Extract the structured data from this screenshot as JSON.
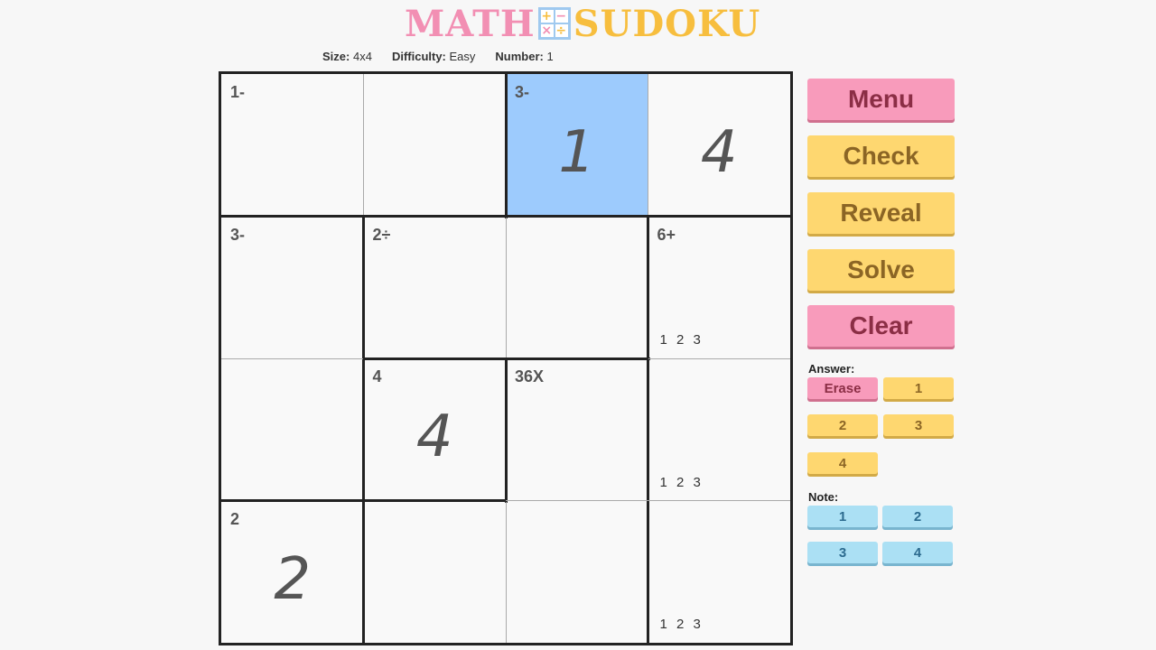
{
  "title": {
    "part1": "MATH",
    "part2": "SUDOKU",
    "logo": [
      "+",
      "−",
      "×",
      "÷"
    ]
  },
  "info": {
    "size_label": "Size:",
    "size": "4x4",
    "difficulty_label": "Difficulty:",
    "difficulty": "Easy",
    "number_label": "Number:",
    "number": "1"
  },
  "board": {
    "cells": [
      {
        "cage": "1-",
        "value": "",
        "notes": ""
      },
      {
        "cage": "",
        "value": "",
        "notes": ""
      },
      {
        "cage": "3-",
        "value": "1",
        "notes": "",
        "selected": true
      },
      {
        "cage": "",
        "value": "4",
        "notes": ""
      },
      {
        "cage": "3-",
        "value": "",
        "notes": ""
      },
      {
        "cage": "2÷",
        "value": "",
        "notes": ""
      },
      {
        "cage": "",
        "value": "",
        "notes": ""
      },
      {
        "cage": "6+",
        "value": "",
        "notes": "1 2 3"
      },
      {
        "cage": "",
        "value": "",
        "notes": ""
      },
      {
        "cage": "4",
        "value": "4",
        "notes": ""
      },
      {
        "cage": "36X",
        "value": "",
        "notes": ""
      },
      {
        "cage": "",
        "value": "",
        "notes": "1 2 3"
      },
      {
        "cage": "2",
        "value": "2",
        "notes": ""
      },
      {
        "cage": "",
        "value": "",
        "notes": ""
      },
      {
        "cage": "",
        "value": "",
        "notes": ""
      },
      {
        "cage": "",
        "value": "",
        "notes": "1 2 3"
      }
    ]
  },
  "buttons": {
    "menu": "Menu",
    "check": "Check",
    "reveal": "Reveal",
    "solve": "Solve",
    "clear": "Clear"
  },
  "answer": {
    "label": "Answer:",
    "erase": "Erase",
    "options": [
      "1",
      "2",
      "3",
      "4"
    ]
  },
  "note": {
    "label": "Note:",
    "options": [
      "1",
      "2",
      "3",
      "4"
    ]
  },
  "colors": {
    "pink": "#f89bbb",
    "yellow": "#fed770",
    "blue": "#abe0f4",
    "selected": "#9dcbfd"
  }
}
